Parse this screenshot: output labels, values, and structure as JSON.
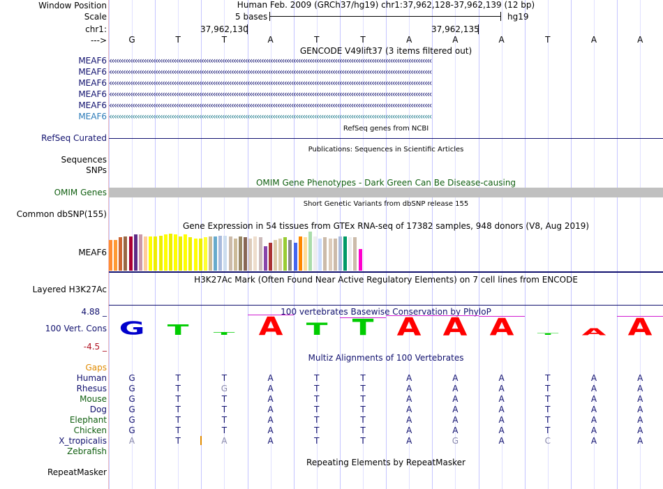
{
  "header": {
    "window_position_label": "Window Position",
    "scale_label": "Scale",
    "chrom_label": "chr1:",
    "arrow_label": "--->",
    "assembly_title": "Human Feb. 2009 (GRCh37/hg19)   chr1:37,962,128-37,962,139 (12 bp)",
    "scale_text": "5 bases",
    "scale_db": "hg19",
    "coord_1": "37,962,130",
    "coord_2": "37,962,135"
  },
  "reference_bases": [
    "G",
    "T",
    "T",
    "A",
    "T",
    "T",
    "A",
    "A",
    "A",
    "T",
    "A",
    "A"
  ],
  "gencode": {
    "title": "GENCODE V49lift37 (3 items filtered out)",
    "items": [
      "MEAF6",
      "MEAF6",
      "MEAF6",
      "MEAF6",
      "MEAF6",
      "MEAF6"
    ]
  },
  "refseq": {
    "label": "RefSeq Curated",
    "title": "RefSeq genes from NCBI"
  },
  "publications": {
    "title": "Publications: Sequences in Scientific Articles",
    "label_sequences": "Sequences",
    "label_snps": "SNPs"
  },
  "omim": {
    "title": "OMIM Gene Phenotypes - Dark Green Can Be Disease-causing",
    "label": "OMIM Genes"
  },
  "dbsnp": {
    "title": "Short Genetic Variants from dbSNP release 155",
    "label": "Common dbSNP(155)"
  },
  "gtex": {
    "title": "Gene Expression in 54 tissues from GTEx RNA-seq of 17382 samples, 948 donors (V8, Aug 2019)",
    "label": "MEAF6",
    "bars": [
      {
        "h": 0.78,
        "c": "#ff8c33"
      },
      {
        "h": 0.78,
        "c": "#ff9933"
      },
      {
        "h": 0.85,
        "c": "#cc6633"
      },
      {
        "h": 0.88,
        "c": "#996644"
      },
      {
        "h": 0.88,
        "c": "#aa0033"
      },
      {
        "h": 0.92,
        "c": "#5e2a87"
      },
      {
        "h": 0.92,
        "c": "#cc99aa"
      },
      {
        "h": 0.88,
        "c": "#ffcc99"
      },
      {
        "h": 0.88,
        "c": "#ffff00"
      },
      {
        "h": 0.88,
        "c": "#eeee00"
      },
      {
        "h": 0.9,
        "c": "#eeee00"
      },
      {
        "h": 0.92,
        "c": "#ffff00"
      },
      {
        "h": 0.95,
        "c": "#eeee00"
      },
      {
        "h": 0.92,
        "c": "#ffff00"
      },
      {
        "h": 0.88,
        "c": "#eeee00"
      },
      {
        "h": 0.92,
        "c": "#ffff00"
      },
      {
        "h": 0.85,
        "c": "#eeee00"
      },
      {
        "h": 0.82,
        "c": "#ffff00"
      },
      {
        "h": 0.82,
        "c": "#eeee00"
      },
      {
        "h": 0.85,
        "c": "#ffff33"
      },
      {
        "h": 0.88,
        "c": "#ccbb99"
      },
      {
        "h": 0.88,
        "c": "#66aacc"
      },
      {
        "h": 0.9,
        "c": "#aabbdd"
      },
      {
        "h": 0.9,
        "c": "#ccddee"
      },
      {
        "h": 0.88,
        "c": "#ccbbaa"
      },
      {
        "h": 0.82,
        "c": "#ccbb99"
      },
      {
        "h": 0.88,
        "c": "#998866"
      },
      {
        "h": 0.85,
        "c": "#886655"
      },
      {
        "h": 0.82,
        "c": "#ddccbb"
      },
      {
        "h": 0.88,
        "c": "#eeddcc"
      },
      {
        "h": 0.85,
        "c": "#ccbbbb"
      },
      {
        "h": 0.62,
        "c": "#8844aa"
      },
      {
        "h": 0.72,
        "c": "#aa3333"
      },
      {
        "h": 0.78,
        "c": "#ddccaa"
      },
      {
        "h": 0.82,
        "c": "#ddccaa"
      },
      {
        "h": 0.85,
        "c": "#99cc33"
      },
      {
        "h": 0.78,
        "c": "#888888"
      },
      {
        "h": 0.72,
        "c": "#4466ee"
      },
      {
        "h": 0.88,
        "c": "#ff8800"
      },
      {
        "h": 0.85,
        "c": "#ffdd99"
      },
      {
        "h": 1.0,
        "c": "#aaddaa"
      },
      {
        "h": 0.88,
        "c": "#eeeeee"
      },
      {
        "h": 0.82,
        "c": "#ccddff"
      },
      {
        "h": 0.85,
        "c": "#ccbbaa"
      },
      {
        "h": 0.82,
        "c": "#ddccbb"
      },
      {
        "h": 0.82,
        "c": "#ccbbaa"
      },
      {
        "h": 0.88,
        "c": "#aabbdd"
      },
      {
        "h": 0.88,
        "c": "#009966"
      },
      {
        "h": 0.85,
        "c": "#eeeeee"
      },
      {
        "h": 0.85,
        "c": "#ccbbaa"
      },
      {
        "h": 0.55,
        "c": "#ff00cc"
      }
    ]
  },
  "h3k27ac": {
    "title": "H3K27Ac Mark (Often Found Near Active Regulatory Elements) on 7 cell lines from ENCODE",
    "label": "Layered H3K27Ac"
  },
  "phylop": {
    "title": "100 vertebrates Basewise Conservation by PhyloP",
    "label": "100 Vert. Cons",
    "max": "4.88 _",
    "min": "-4.5 _",
    "scores": [
      2.2,
      1.7,
      0.4,
      3.1,
      2.0,
      2.7,
      3.0,
      3.0,
      2.9,
      0.3,
      1.1,
      2.9
    ],
    "colors": {
      "A": "#ff0000",
      "T": "#00cc00",
      "G": "#0000cc",
      "C": "#0000cc"
    }
  },
  "multiz": {
    "title": "Multiz Alignments of 100 Vertebrates",
    "gaps_label": "Gaps",
    "species": [
      {
        "name": "Human",
        "color": "#10106e",
        "bases": [
          "G",
          "T",
          "T",
          "A",
          "T",
          "T",
          "A",
          "A",
          "A",
          "T",
          "A",
          "A"
        ],
        "grey": []
      },
      {
        "name": "Rhesus",
        "color": "#10106e",
        "bases": [
          "G",
          "T",
          "G",
          "A",
          "T",
          "T",
          "A",
          "A",
          "A",
          "T",
          "A",
          "A"
        ],
        "grey": [
          2
        ]
      },
      {
        "name": "Mouse",
        "color": "#0f5e0f",
        "bases": [
          "G",
          "T",
          "T",
          "A",
          "T",
          "T",
          "A",
          "A",
          "A",
          "T",
          "A",
          "A"
        ],
        "grey": []
      },
      {
        "name": "Dog",
        "color": "#10106e",
        "bases": [
          "G",
          "T",
          "T",
          "A",
          "T",
          "T",
          "A",
          "A",
          "A",
          "T",
          "A",
          "A"
        ],
        "grey": []
      },
      {
        "name": "Elephant",
        "color": "#0f5e0f",
        "bases": [
          "G",
          "T",
          "T",
          "A",
          "T",
          "T",
          "A",
          "A",
          "A",
          "T",
          "A",
          "A"
        ],
        "grey": []
      },
      {
        "name": "Chicken",
        "color": "#0f5e0f",
        "bases": [
          "G",
          "T",
          "T",
          "A",
          "T",
          "T",
          "A",
          "A",
          "A",
          "T",
          "A",
          "A"
        ],
        "grey": []
      },
      {
        "name": "X_tropicalis",
        "color": "#10106e",
        "bases": [
          "A",
          "T",
          "A",
          "A",
          "T",
          "T",
          "A",
          "G",
          "A",
          "C",
          "A",
          "A"
        ],
        "grey": [
          0,
          2,
          7,
          9
        ]
      },
      {
        "name": "Zebrafish",
        "color": "#0f5e0f",
        "bases": [],
        "grey": []
      }
    ]
  },
  "repeatmasker": {
    "title": "Repeating Elements by RepeatMasker",
    "label": "RepeatMasker"
  }
}
